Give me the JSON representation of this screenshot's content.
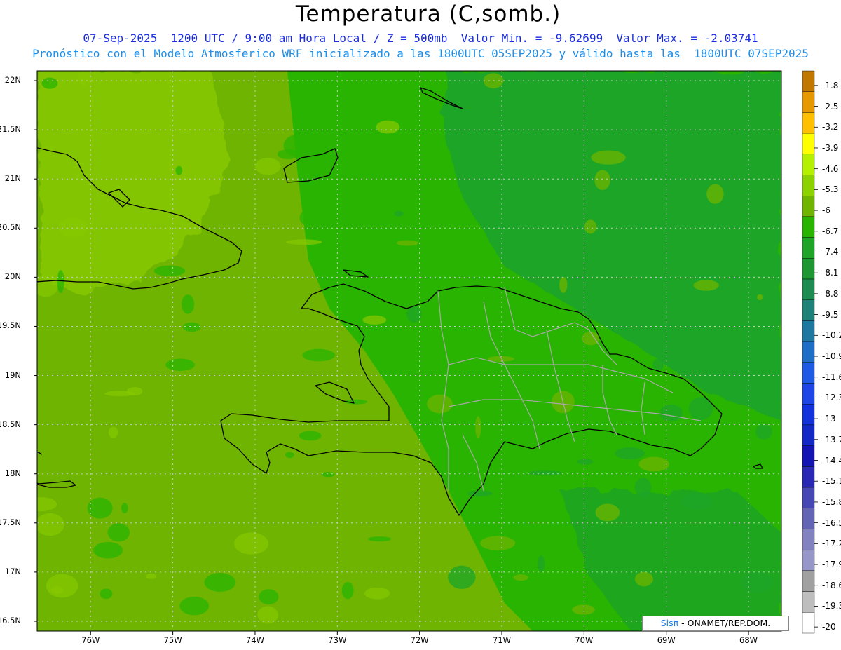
{
  "header": {
    "title": "Temperatura (C,somb.)",
    "subtitle_1": "07-Sep-2025  1200 UTC / 9:00 am Hora Local / Z = 500mb  Valor Min. = -9.62699  Valor Max. = -2.03741",
    "subtitle_2": "Pronóstico con el Modelo Atmosferico WRF inicializado a las 1800UTC_05SEP2025 y válido hasta las  1800UTC_07SEP2025"
  },
  "credit": {
    "brand": "Sisπ",
    "rest": "- ONAMET/REP.DOM."
  },
  "axes": {
    "lat_labels": [
      "22N",
      "21.5N",
      "21N",
      "20.5N",
      "20N",
      "19.5N",
      "19N",
      "18.5N",
      "18N",
      "17.5N",
      "17N",
      "16.5N"
    ],
    "lat_values": [
      22,
      21.5,
      21,
      20.5,
      20,
      19.5,
      19,
      18.5,
      18,
      17.5,
      17,
      16.5
    ],
    "lon_labels": [
      "76W",
      "75W",
      "74W",
      "73W",
      "72W",
      "71W",
      "70W",
      "69W",
      "68W"
    ],
    "lon_values": [
      -76,
      -75,
      -74,
      -73,
      -72,
      -71,
      -70,
      -69,
      -68
    ],
    "lon_range": [
      -76.65,
      -67.6
    ],
    "lat_range": [
      16.4,
      22.1
    ]
  },
  "legend": {
    "labels": [
      "-1.8",
      "-2.5",
      "-3.2",
      "-3.9",
      "-4.6",
      "-5.3",
      "-6",
      "-6.7",
      "-7.4",
      "-8.1",
      "-8.8",
      "-9.5",
      "-10.2",
      "-10.9",
      "-11.6",
      "-12.3",
      "-13",
      "-13.7",
      "-14.4",
      "-15.1",
      "-15.8",
      "-16.5",
      "-17.2",
      "-17.9",
      "-18.6",
      "-19.3",
      "-20"
    ],
    "colors": [
      "#c07800",
      "#e69800",
      "#ffc000",
      "#ffff00",
      "#b4f000",
      "#8cd200",
      "#6eb400",
      "#28b400",
      "#1ea528",
      "#1e9632",
      "#1e8c50",
      "#1e8278",
      "#1e78a0",
      "#1e6ec8",
      "#1e5ae6",
      "#1e46e6",
      "#1432dc",
      "#1428c8",
      "#1414b4",
      "#2828b4",
      "#4646b4",
      "#6464b4",
      "#8282c0",
      "#9696c8",
      "#a0a0a0",
      "#bebebe",
      "#ffffff"
    ]
  },
  "fields": {
    "west_color": "#86c800",
    "mid_color": "#6eb400",
    "east_color": "#28b400",
    "deep_color": "#1ea528"
  }
}
